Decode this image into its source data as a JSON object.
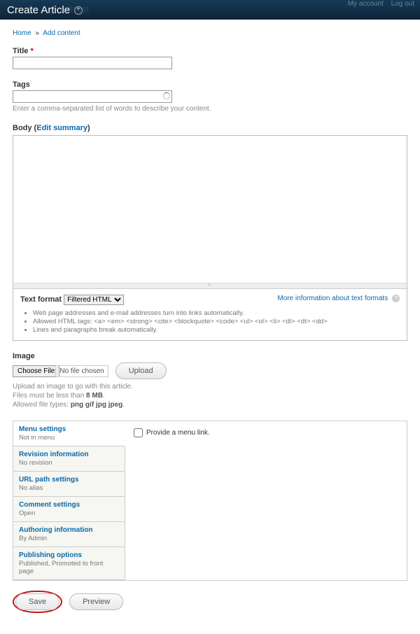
{
  "topbar": {
    "title": "Create Article",
    "ghost": "alhost",
    "my_account": "My account",
    "logout": "Log out"
  },
  "breadcrumb": {
    "home": "Home",
    "add_content": "Add content"
  },
  "title_field": {
    "label": "Title",
    "value": ""
  },
  "tags": {
    "label": "Tags",
    "value": "",
    "help": "Enter a comma-separated list of words to describe your content."
  },
  "body": {
    "label_prefix": "Body (",
    "summary_link": "Edit summary",
    "label_suffix": ")",
    "value": ""
  },
  "format": {
    "label": "Text format",
    "selected": "Filtered HTML",
    "more_info": "More information about text formats",
    "tips": [
      "Web page addresses and e-mail addresses turn into links automatically.",
      "Allowed HTML tags: <a> <em> <strong> <cite> <blockquote> <code> <ul> <ol> <li> <dl> <dt> <dd>",
      "Lines and paragraphs break automatically."
    ]
  },
  "image": {
    "label": "Image",
    "choose": "Choose File",
    "no_file": "No file chosen",
    "upload": "Upload",
    "help1": "Upload an image to go with this article.",
    "help2_a": "Files must be less than ",
    "help2_b": "8 MB",
    "help2_c": ".",
    "help3_a": "Allowed file types: ",
    "help3_b": "png gif jpg jpeg",
    "help3_c": "."
  },
  "vtabs": [
    {
      "title": "Menu settings",
      "summary": "Not in menu"
    },
    {
      "title": "Revision information",
      "summary": "No revision"
    },
    {
      "title": "URL path settings",
      "summary": "No alias"
    },
    {
      "title": "Comment settings",
      "summary": "Open"
    },
    {
      "title": "Authoring information",
      "summary": "By Admin"
    },
    {
      "title": "Publishing options",
      "summary": "Published, Promoted to front page"
    }
  ],
  "menu_pane": {
    "checkbox_label": "Provide a menu link."
  },
  "actions": {
    "save": "Save",
    "preview": "Preview"
  }
}
